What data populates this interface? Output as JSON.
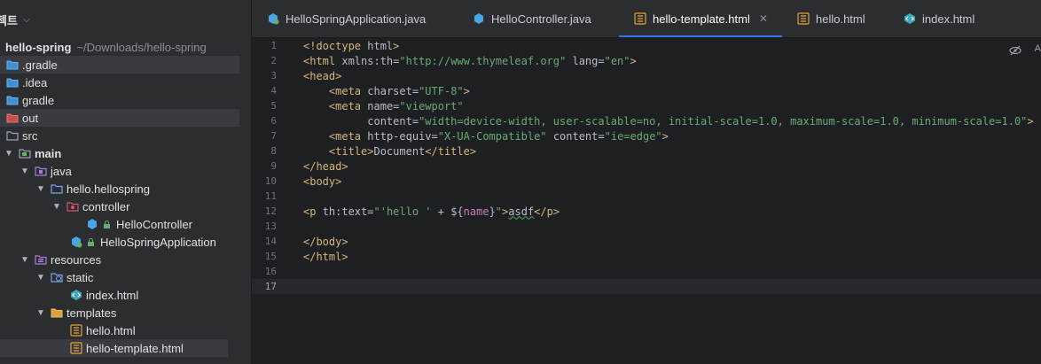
{
  "project": {
    "header_title": "젝트",
    "root_name": "hello-spring",
    "root_path": "~/Downloads/hello-spring",
    "items": [
      {
        "label": ".gradle"
      },
      {
        "label": ".idea"
      },
      {
        "label": "gradle"
      },
      {
        "label": "out"
      },
      {
        "label": "src"
      },
      {
        "label": "main"
      },
      {
        "label": "java"
      },
      {
        "label": "hello.hellospring"
      },
      {
        "label": "controller"
      },
      {
        "label": "HelloController"
      },
      {
        "label": "HelloSpringApplication"
      },
      {
        "label": "resources"
      },
      {
        "label": "static"
      },
      {
        "label": "index.html"
      },
      {
        "label": "templates"
      },
      {
        "label": "hello.html"
      },
      {
        "label": "hello-template.html"
      }
    ]
  },
  "tabs": [
    {
      "label": "HelloSpringApplication.java"
    },
    {
      "label": "HelloController.java"
    },
    {
      "label": "hello-template.html"
    },
    {
      "label": "hello.html"
    },
    {
      "label": "index.html"
    }
  ],
  "editor": {
    "line_numbers": [
      "1",
      "2",
      "3",
      "4",
      "5",
      "6",
      "7",
      "8",
      "9",
      "10",
      "11",
      "12",
      "13",
      "14",
      "15",
      "16",
      "17"
    ],
    "edge_letter": "A"
  },
  "colors": {
    "accent": "#3574f0",
    "tag": "#d5b778",
    "string": "#6aab73",
    "variable": "#c77dbb"
  }
}
